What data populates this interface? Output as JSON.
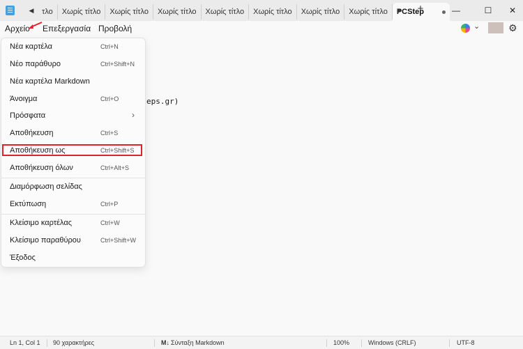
{
  "window": {
    "tabs": [
      "τλο",
      "Χωρίς τίτλο",
      "Χωρίς τίτλο",
      "Χωρίς τίτλο",
      "Χωρίς τίτλο",
      "Χωρίς τίτλο",
      "Χωρίς τίτλο",
      "Χωρίς τίτλο"
    ],
    "active_tab": "PCStep",
    "new_tab_glyph": "+",
    "scroll_left_glyph": "◀",
    "scroll_right_glyph": "▶",
    "minimize_glyph": "—",
    "maximize_glyph": "☐",
    "close_glyph": "✕"
  },
  "menubar": {
    "file": "Αρχείο",
    "edit": "Επεξεργασία",
    "view": "Προβολή",
    "chevron_glyph": "⌄",
    "settings_glyph": "⚙"
  },
  "editor": {
    "visible_text": "eps.gr)"
  },
  "file_menu": {
    "items": [
      {
        "label": "Νέα καρτέλα",
        "shortcut": "Ctrl+N"
      },
      {
        "label": "Νέο παράθυρο",
        "shortcut": "Ctrl+Shift+N"
      },
      {
        "label": "Νέα καρτέλα Markdown",
        "shortcut": ""
      },
      {
        "label": "Άνοιγμα",
        "shortcut": "Ctrl+O"
      },
      {
        "label": "Πρόσφατα",
        "shortcut": "›"
      },
      {
        "label": "Αποθήκευση",
        "shortcut": "Ctrl+S"
      },
      {
        "label": "Αποθήκευση ως",
        "shortcut": "Ctrl+Shift+S"
      },
      {
        "label": "Αποθήκευση όλων",
        "shortcut": "Ctrl+Alt+S"
      },
      {
        "label": "Διαμόρφωση σελίδας",
        "shortcut": ""
      },
      {
        "label": "Εκτύπωση",
        "shortcut": "Ctrl+P"
      },
      {
        "label": "Κλείσιμο καρτέλας",
        "shortcut": "Ctrl+W"
      },
      {
        "label": "Κλείσιμο παραθύρου",
        "shortcut": "Ctrl+Shift+W"
      },
      {
        "label": "Έξοδος",
        "shortcut": ""
      }
    ],
    "highlighted_item": "Αποθήκευση ως"
  },
  "statusbar": {
    "position": "Ln 1, Col 1",
    "char_count": "90 χαρακτήρες",
    "markdown_glyph": "M↓",
    "markdown": "Σύνταξη Markdown",
    "zoom": "100%",
    "line_ending": "Windows (CRLF)",
    "encoding": "UTF-8"
  },
  "colors": {
    "highlight_border": "#e0232a",
    "arrow": "#e0232a"
  }
}
